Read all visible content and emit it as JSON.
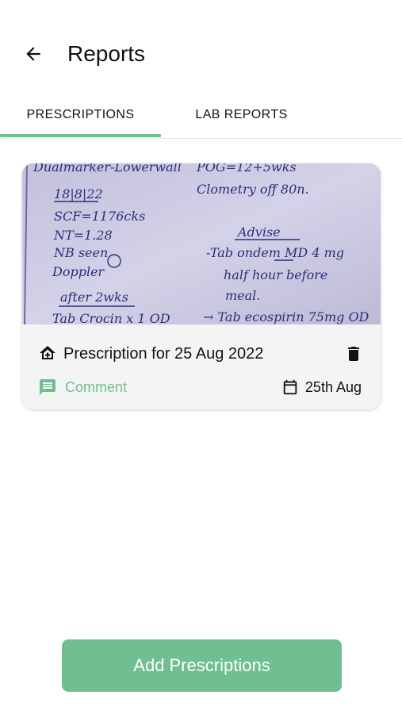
{
  "header": {
    "title": "Reports",
    "back_icon": "arrow-left-icon"
  },
  "tabs": [
    {
      "label": "PRESCRIPTIONS",
      "active": true
    },
    {
      "label": "LAB REPORTS",
      "active": false
    }
  ],
  "colors": {
    "accent": "#6fbf92",
    "button": "#70bf93",
    "card_bg": "#f4f4f4"
  },
  "prescriptions": [
    {
      "title": "Prescription for 25 Aug 2022",
      "comment_label": "Comment",
      "date": "25th Aug",
      "icons": {
        "type": "home-icon",
        "delete": "trash-icon",
        "comment": "comment-icon",
        "date": "calendar-icon"
      },
      "image_text": {
        "left": [
          "Dualmarker-Lowerwall",
          "18|8|22",
          "SCF=1176cks",
          "NT=1.28",
          "NB seen",
          "Doppler",
          "after 2wks",
          "Tab Crocin x 1 OD"
        ],
        "right": [
          "POG=12+5wks",
          "Clometry off 80n.",
          "Advise",
          "-Tab ondem MD 4 mg",
          "half hour before",
          "meal.",
          "→ Tab ecospirin 75mg OD"
        ]
      }
    }
  ],
  "footer": {
    "add_button_label": "Add Prescriptions"
  }
}
